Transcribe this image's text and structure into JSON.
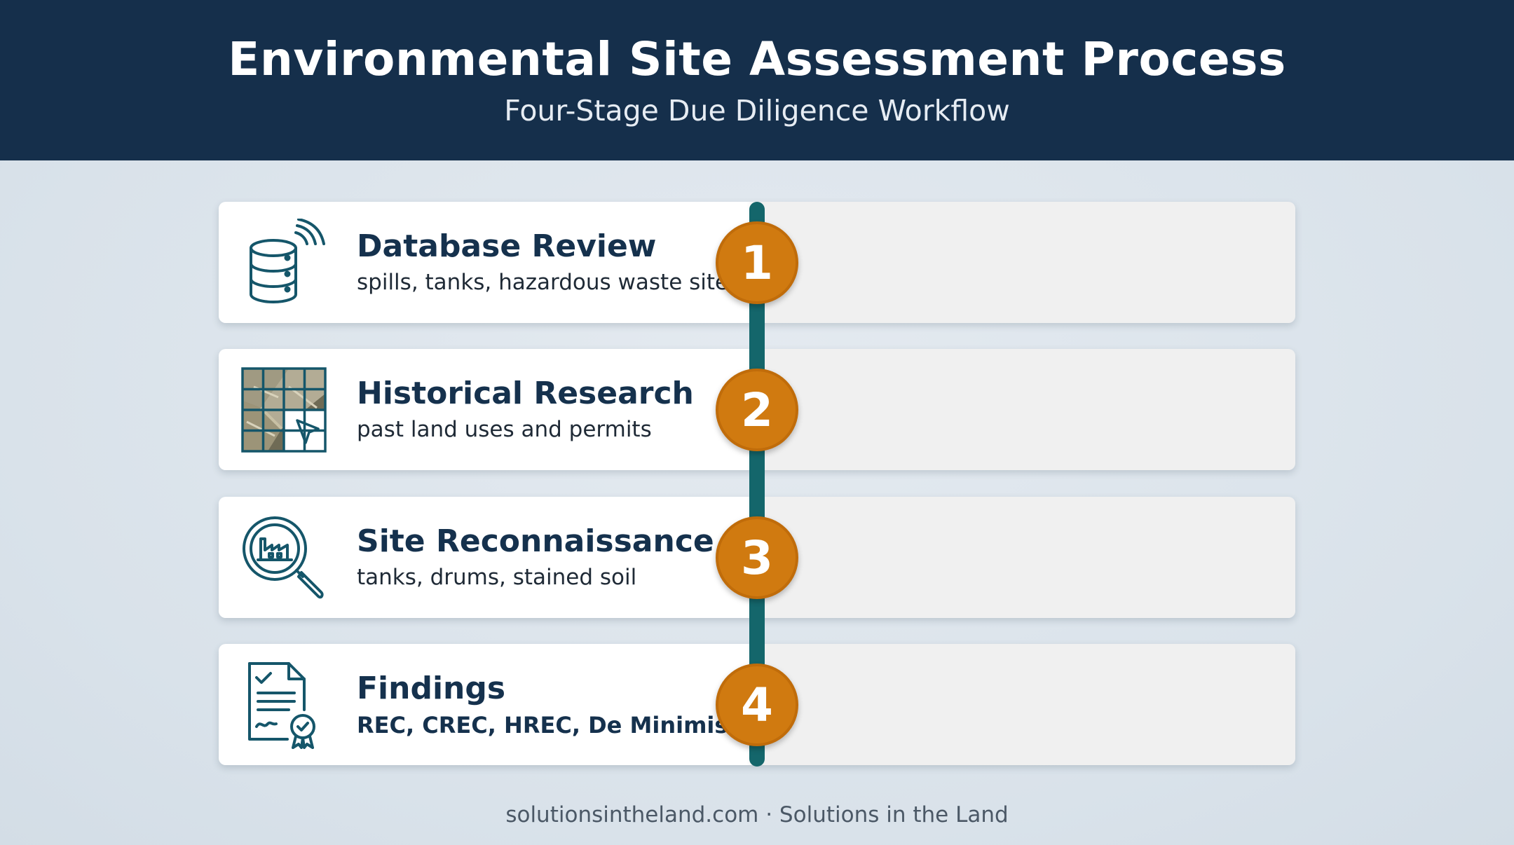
{
  "header": {
    "title": "Environmental Site Assessment Process",
    "subtitle": "Four-Stage Due Diligence Workflow"
  },
  "stages": [
    {
      "number": "1",
      "title": "Database Review",
      "description": "spills, tanks, hazardous waste sites",
      "icon": "database-icon"
    },
    {
      "number": "2",
      "title": "Historical Research",
      "description": "past land uses and permits",
      "icon": "aerial-map-icon"
    },
    {
      "number": "3",
      "title": "Site Reconnaissance",
      "description": "tanks, drums, stained soil",
      "icon": "magnifier-factory-icon"
    },
    {
      "number": "4",
      "title": "Findings",
      "description": "REC, CREC, HREC, De Minimis",
      "icon": "certified-report-icon"
    }
  ],
  "footer": {
    "text": "solutionsintheland.com · Solutions in the Land"
  },
  "colors": {
    "header_bg": "#152f4b",
    "timeline": "#14666b",
    "badge": "#d07a10",
    "title_text": "#15314d"
  }
}
